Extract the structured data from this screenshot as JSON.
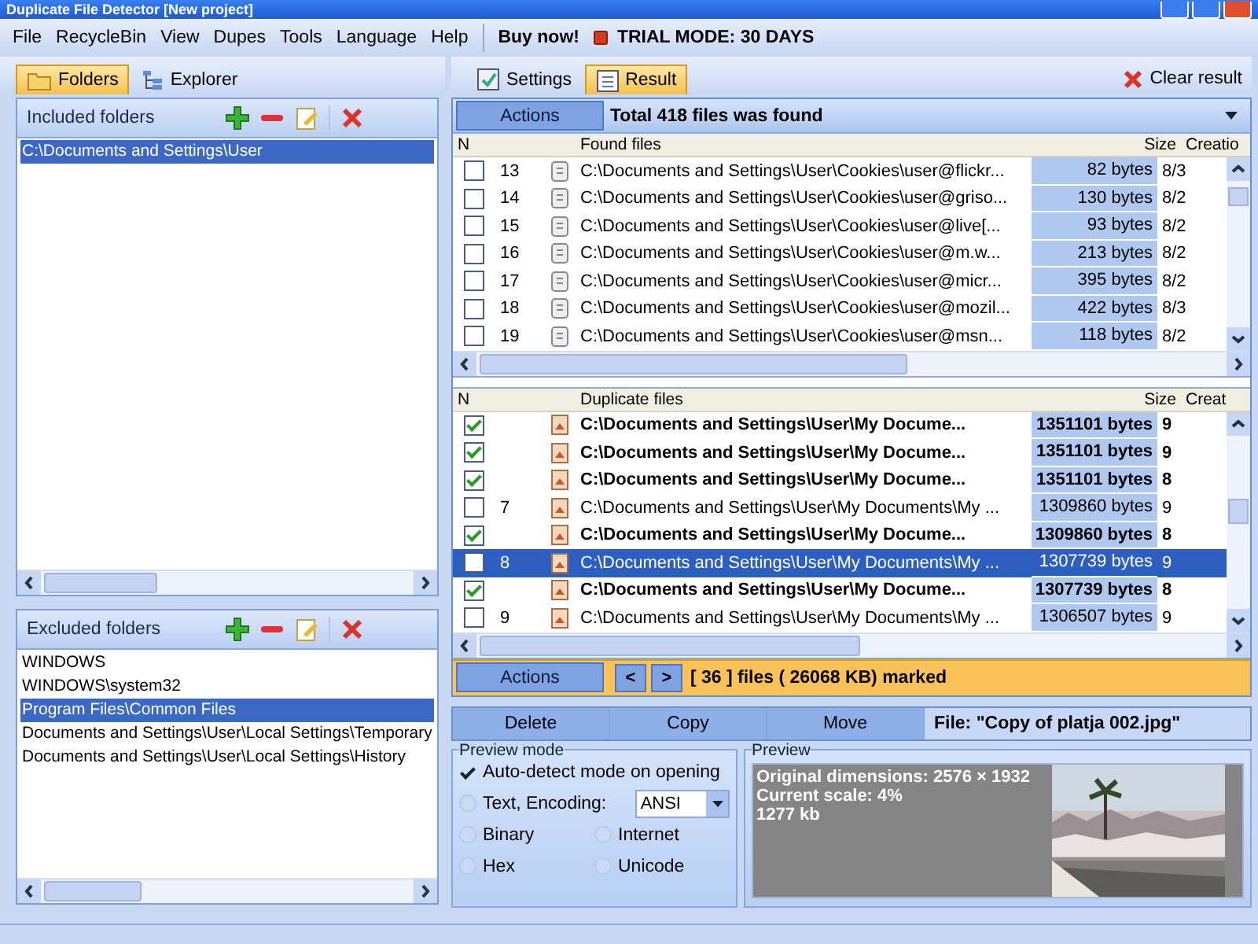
{
  "window": {
    "title": "Duplicate File Detector [New project]"
  },
  "menu": {
    "items": [
      "File",
      "RecycleBin",
      "View",
      "Dupes",
      "Tools",
      "Language",
      "Help"
    ],
    "buy": "Buy now!",
    "trial": "TRIAL MODE: 30 DAYS"
  },
  "left_tabs": [
    {
      "label": "Folders",
      "selected": true
    },
    {
      "label": "Explorer",
      "selected": false
    }
  ],
  "included": {
    "title": "Included folders",
    "items": [
      {
        "label": "C:\\Documents and Settings\\User",
        "selected": true
      }
    ]
  },
  "excluded": {
    "title": "Excluded folders",
    "items": [
      {
        "label": "WINDOWS",
        "selected": false
      },
      {
        "label": "WINDOWS\\system32",
        "selected": false
      },
      {
        "label": "Program Files\\Common Files",
        "selected": true
      },
      {
        "label": "Documents and Settings\\User\\Local Settings\\Temporary",
        "selected": false
      },
      {
        "label": "Documents and Settings\\User\\Local Settings\\History",
        "selected": false
      }
    ]
  },
  "right_tabs": [
    {
      "label": "Settings",
      "selected": false
    },
    {
      "label": "Result",
      "selected": true
    }
  ],
  "clear_button": "Clear result",
  "found": {
    "actions": "Actions",
    "summary": "Total 418 files was found",
    "columns": [
      "N",
      "Found files",
      "Size",
      "Creatio"
    ],
    "rows": [
      {
        "checked": false,
        "n": "13",
        "path": "C:\\Documents and Settings\\User\\Cookies\\user@flickr...",
        "size": "82 bytes",
        "date": "8/3"
      },
      {
        "checked": false,
        "n": "14",
        "path": "C:\\Documents and Settings\\User\\Cookies\\user@griso...",
        "size": "130 bytes",
        "date": "8/2"
      },
      {
        "checked": false,
        "n": "15",
        "path": "C:\\Documents and Settings\\User\\Cookies\\user@live[...",
        "size": "93 bytes",
        "date": "8/2"
      },
      {
        "checked": false,
        "n": "16",
        "path": "C:\\Documents and Settings\\User\\Cookies\\user@m.w...",
        "size": "213 bytes",
        "date": "8/2"
      },
      {
        "checked": false,
        "n": "17",
        "path": "C:\\Documents and Settings\\User\\Cookies\\user@micr...",
        "size": "395 bytes",
        "date": "8/2"
      },
      {
        "checked": false,
        "n": "18",
        "path": "C:\\Documents and Settings\\User\\Cookies\\user@mozil...",
        "size": "422 bytes",
        "date": "8/3"
      },
      {
        "checked": false,
        "n": "19",
        "path": "C:\\Documents and Settings\\User\\Cookies\\user@msn...",
        "size": "118 bytes",
        "date": "8/2"
      }
    ]
  },
  "duplicates": {
    "columns": [
      "N",
      "Duplicate files",
      "Size",
      "Creat"
    ],
    "rows": [
      {
        "checked": true,
        "selected": false,
        "n": "",
        "path": "C:\\Documents and Settings\\User\\My Docume...",
        "size": "1351101 bytes",
        "date": "9"
      },
      {
        "checked": true,
        "selected": false,
        "n": "",
        "path": "C:\\Documents and Settings\\User\\My Docume...",
        "size": "1351101 bytes",
        "date": "9"
      },
      {
        "checked": true,
        "selected": false,
        "n": "",
        "path": "C:\\Documents and Settings\\User\\My Docume...",
        "size": "1351101 bytes",
        "date": "8"
      },
      {
        "checked": false,
        "selected": false,
        "n": "7",
        "path": "C:\\Documents and Settings\\User\\My Documents\\My ...",
        "size": "1309860 bytes",
        "date": "9"
      },
      {
        "checked": true,
        "selected": false,
        "n": "",
        "path": "C:\\Documents and Settings\\User\\My Docume...",
        "size": "1309860 bytes",
        "date": "8"
      },
      {
        "checked": false,
        "selected": true,
        "n": "8",
        "path": "C:\\Documents and Settings\\User\\My Documents\\My ...",
        "size": "1307739 bytes",
        "date": "9"
      },
      {
        "checked": true,
        "selected": false,
        "n": "",
        "path": "C:\\Documents and Settings\\User\\My Docume...",
        "size": "1307739 bytes",
        "date": "8"
      },
      {
        "checked": false,
        "selected": false,
        "n": "9",
        "path": "C:\\Documents and Settings\\User\\My Documents\\My ...",
        "size": "1306507 bytes",
        "date": "9"
      }
    ]
  },
  "marked_bar": {
    "actions": "Actions",
    "prev": "<",
    "next": ">",
    "summary": "[ 36 ] files ( 26068 KB) marked"
  },
  "file_actions": [
    "Delete",
    "Copy",
    "Move"
  ],
  "file_label": "File: \"Copy of platja 002.jpg\"",
  "preview_mode": {
    "title": "Preview mode",
    "auto_detect": {
      "label": "Auto-detect mode on opening",
      "checked": true
    },
    "encoding": "ANSI",
    "options": [
      {
        "label": "Text, Encoding:",
        "selected": false
      },
      {
        "label": "Binary",
        "selected": false
      },
      {
        "label": "Internet",
        "selected": false
      },
      {
        "label": "Hex",
        "selected": false
      },
      {
        "label": "Unicode",
        "selected": false
      }
    ]
  },
  "preview": {
    "title": "Preview",
    "lines": [
      "Original dimensions: 2576 × 1932",
      "Current scale: 4%",
      "1277 kb"
    ]
  }
}
